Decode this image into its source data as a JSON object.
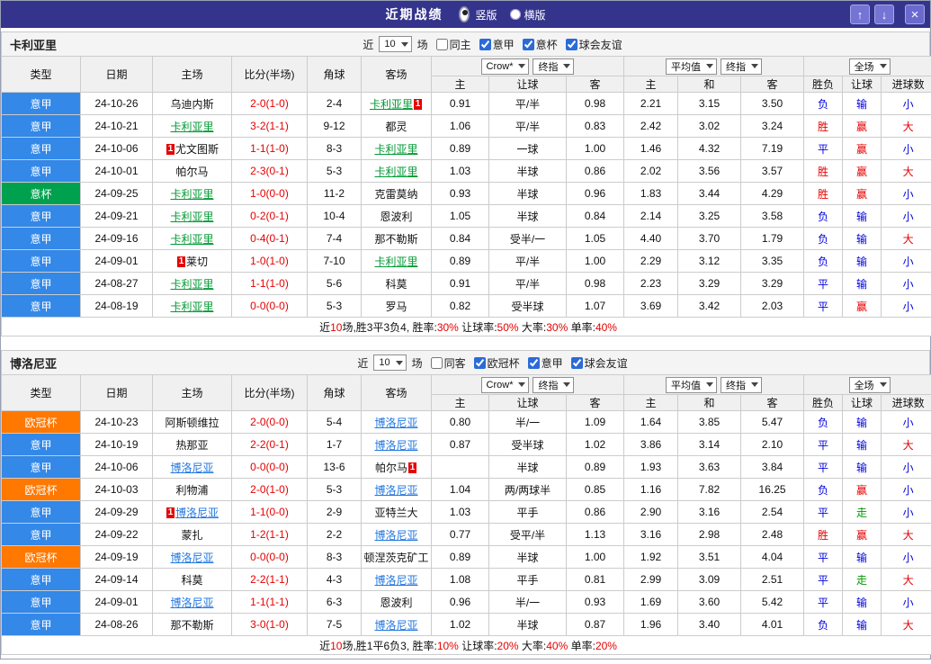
{
  "titlebar": {
    "title": "近期战绩",
    "radios": [
      {
        "label": "竖版",
        "selected": true
      },
      {
        "label": "横版",
        "selected": false
      }
    ]
  },
  "icons": {
    "up": "↑",
    "down": "↓",
    "close": "×",
    "chevron": "▼"
  },
  "header": {
    "static_cols": [
      "类型",
      "日期",
      "主场",
      "比分(半场)",
      "角球",
      "客场"
    ],
    "groups": [
      {
        "selects": [
          "Crow*",
          "终指"
        ],
        "cols": [
          "主",
          "让球",
          "客"
        ]
      },
      {
        "selects": [
          "平均值",
          "终指"
        ],
        "cols": [
          "主",
          "和",
          "客"
        ]
      },
      {
        "selects": [
          "全场"
        ],
        "cols": [
          "胜负",
          "让球",
          "进球数"
        ]
      }
    ]
  },
  "colors": {
    "type": {
      "意甲": "#3388e8",
      "意杯": "#00a14e",
      "欧冠杯": "#ff7800"
    },
    "result": {
      "胜": "#e60000",
      "赢": "#e60000",
      "大": "#e60000",
      "负": "#0000dd",
      "输": "#0000dd",
      "小": "#0000dd",
      "平": "#0000dd",
      "走": "#009900"
    }
  },
  "sections": [
    {
      "team": "卡利亚里",
      "focus_color": "#009933",
      "filter": {
        "prefix": "近",
        "count": "10",
        "suffix": "场",
        "checkboxes": [
          {
            "label": "同主",
            "checked": false
          },
          {
            "label": "意甲",
            "checked": true
          },
          {
            "label": "意杯",
            "checked": true
          },
          {
            "label": "球会友谊",
            "checked": true
          }
        ]
      },
      "rows": [
        {
          "type": "意甲",
          "date": "24-10-26",
          "home": {
            "name": "乌迪内斯",
            "focus": false
          },
          "score": "2-0(1-0)",
          "corners": "2-4",
          "away": {
            "name": "卡利亚里",
            "focus": true,
            "badge_after": "1"
          },
          "odds": [
            "0.91",
            "平/半",
            "0.98"
          ],
          "avg": [
            "2.21",
            "3.15",
            "3.50"
          ],
          "results": [
            "负",
            "输",
            "小"
          ]
        },
        {
          "type": "意甲",
          "date": "24-10-21",
          "home": {
            "name": "卡利亚里",
            "focus": true
          },
          "score": "3-2(1-1)",
          "corners": "9-12",
          "away": {
            "name": "都灵",
            "focus": false
          },
          "odds": [
            "1.06",
            "平/半",
            "0.83"
          ],
          "avg": [
            "2.42",
            "3.02",
            "3.24"
          ],
          "results": [
            "胜",
            "赢",
            "大"
          ]
        },
        {
          "type": "意甲",
          "date": "24-10-06",
          "home": {
            "name": "尤文图斯",
            "focus": false,
            "badge_before": "1"
          },
          "score": "1-1(1-0)",
          "corners": "8-3",
          "away": {
            "name": "卡利亚里",
            "focus": true
          },
          "odds": [
            "0.89",
            "一球",
            "1.00"
          ],
          "avg": [
            "1.46",
            "4.32",
            "7.19"
          ],
          "results": [
            "平",
            "赢",
            "小"
          ]
        },
        {
          "type": "意甲",
          "date": "24-10-01",
          "home": {
            "name": "帕尔马",
            "focus": false
          },
          "score": "2-3(0-1)",
          "corners": "5-3",
          "away": {
            "name": "卡利亚里",
            "focus": true
          },
          "odds": [
            "1.03",
            "半球",
            "0.86"
          ],
          "avg": [
            "2.02",
            "3.56",
            "3.57"
          ],
          "results": [
            "胜",
            "赢",
            "大"
          ]
        },
        {
          "type": "意杯",
          "date": "24-09-25",
          "home": {
            "name": "卡利亚里",
            "focus": true
          },
          "score": "1-0(0-0)",
          "corners": "11-2",
          "away": {
            "name": "克雷莫纳",
            "focus": false
          },
          "odds": [
            "0.93",
            "半球",
            "0.96"
          ],
          "avg": [
            "1.83",
            "3.44",
            "4.29"
          ],
          "results": [
            "胜",
            "赢",
            "小"
          ]
        },
        {
          "type": "意甲",
          "date": "24-09-21",
          "home": {
            "name": "卡利亚里",
            "focus": true
          },
          "score": "0-2(0-1)",
          "corners": "10-4",
          "away": {
            "name": "恩波利",
            "focus": false
          },
          "odds": [
            "1.05",
            "半球",
            "0.84"
          ],
          "avg": [
            "2.14",
            "3.25",
            "3.58"
          ],
          "results": [
            "负",
            "输",
            "小"
          ]
        },
        {
          "type": "意甲",
          "date": "24-09-16",
          "home": {
            "name": "卡利亚里",
            "focus": true
          },
          "score": "0-4(0-1)",
          "corners": "7-4",
          "away": {
            "name": "那不勒斯",
            "focus": false
          },
          "odds": [
            "0.84",
            "受半/一",
            "1.05"
          ],
          "avg": [
            "4.40",
            "3.70",
            "1.79"
          ],
          "results": [
            "负",
            "输",
            "大"
          ]
        },
        {
          "type": "意甲",
          "date": "24-09-01",
          "home": {
            "name": "莱切",
            "focus": false,
            "badge_before": "1"
          },
          "score": "1-0(1-0)",
          "corners": "7-10",
          "away": {
            "name": "卡利亚里",
            "focus": true
          },
          "odds": [
            "0.89",
            "平/半",
            "1.00"
          ],
          "avg": [
            "2.29",
            "3.12",
            "3.35"
          ],
          "results": [
            "负",
            "输",
            "小"
          ]
        },
        {
          "type": "意甲",
          "date": "24-08-27",
          "home": {
            "name": "卡利亚里",
            "focus": true
          },
          "score": "1-1(1-0)",
          "corners": "5-6",
          "away": {
            "name": "科莫",
            "focus": false
          },
          "odds": [
            "0.91",
            "平/半",
            "0.98"
          ],
          "avg": [
            "2.23",
            "3.29",
            "3.29"
          ],
          "results": [
            "平",
            "输",
            "小"
          ]
        },
        {
          "type": "意甲",
          "date": "24-08-19",
          "home": {
            "name": "卡利亚里",
            "focus": true
          },
          "score": "0-0(0-0)",
          "corners": "5-3",
          "away": {
            "name": "罗马",
            "focus": false
          },
          "odds": [
            "0.82",
            "受半球",
            "1.07"
          ],
          "avg": [
            "3.69",
            "3.42",
            "2.03"
          ],
          "results": [
            "平",
            "赢",
            "小"
          ]
        }
      ],
      "summary": [
        [
          "近",
          0
        ],
        [
          "10",
          1
        ],
        [
          "场,胜3平3负4, 胜率:",
          0
        ],
        [
          "30%",
          1
        ],
        [
          " 让球率:",
          0
        ],
        [
          "50%",
          1
        ],
        [
          " 大率:",
          0
        ],
        [
          "30%",
          1
        ],
        [
          " 单率:",
          0
        ],
        [
          "40%",
          1
        ]
      ]
    },
    {
      "team": "博洛尼亚",
      "focus_color": "#2277e0",
      "filter": {
        "prefix": "近",
        "count": "10",
        "suffix": "场",
        "checkboxes": [
          {
            "label": "同客",
            "checked": false
          },
          {
            "label": "欧冠杯",
            "checked": true
          },
          {
            "label": "意甲",
            "checked": true
          },
          {
            "label": "球会友谊",
            "checked": true
          }
        ]
      },
      "rows": [
        {
          "type": "欧冠杯",
          "date": "24-10-23",
          "home": {
            "name": "阿斯顿维拉",
            "focus": false
          },
          "score": "2-0(0-0)",
          "corners": "5-4",
          "away": {
            "name": "博洛尼亚",
            "focus": true
          },
          "odds": [
            "0.80",
            "半/一",
            "1.09"
          ],
          "avg": [
            "1.64",
            "3.85",
            "5.47"
          ],
          "results": [
            "负",
            "输",
            "小"
          ]
        },
        {
          "type": "意甲",
          "date": "24-10-19",
          "home": {
            "name": "热那亚",
            "focus": false
          },
          "score": "2-2(0-1)",
          "corners": "1-7",
          "away": {
            "name": "博洛尼亚",
            "focus": true
          },
          "odds": [
            "0.87",
            "受半球",
            "1.02"
          ],
          "avg": [
            "3.86",
            "3.14",
            "2.10"
          ],
          "results": [
            "平",
            "输",
            "大"
          ]
        },
        {
          "type": "意甲",
          "date": "24-10-06",
          "home": {
            "name": "博洛尼亚",
            "focus": true
          },
          "score": "0-0(0-0)",
          "corners": "13-6",
          "away": {
            "name": "帕尔马",
            "focus": false,
            "badge_after": "1"
          },
          "odds": [
            "",
            "半球",
            "0.89"
          ],
          "avg": [
            "1.93",
            "3.63",
            "3.84"
          ],
          "results": [
            "平",
            "输",
            "小"
          ]
        },
        {
          "type": "欧冠杯",
          "date": "24-10-03",
          "home": {
            "name": "利物浦",
            "focus": false
          },
          "score": "2-0(1-0)",
          "corners": "5-3",
          "away": {
            "name": "博洛尼亚",
            "focus": true
          },
          "odds": [
            "1.04",
            "两/两球半",
            "0.85"
          ],
          "avg": [
            "1.16",
            "7.82",
            "16.25"
          ],
          "results": [
            "负",
            "赢",
            "小"
          ]
        },
        {
          "type": "意甲",
          "date": "24-09-29",
          "home": {
            "name": "博洛尼亚",
            "focus": true,
            "badge_before": "1"
          },
          "score": "1-1(0-0)",
          "corners": "2-9",
          "away": {
            "name": "亚特兰大",
            "focus": false
          },
          "odds": [
            "1.03",
            "平手",
            "0.86"
          ],
          "avg": [
            "2.90",
            "3.16",
            "2.54"
          ],
          "results": [
            "平",
            "走",
            "小"
          ]
        },
        {
          "type": "意甲",
          "date": "24-09-22",
          "home": {
            "name": "蒙扎",
            "focus": false
          },
          "score": "1-2(1-1)",
          "corners": "2-2",
          "away": {
            "name": "博洛尼亚",
            "focus": true
          },
          "odds": [
            "0.77",
            "受平/半",
            "1.13"
          ],
          "avg": [
            "3.16",
            "2.98",
            "2.48"
          ],
          "results": [
            "胜",
            "赢",
            "大"
          ]
        },
        {
          "type": "欧冠杯",
          "date": "24-09-19",
          "home": {
            "name": "博洛尼亚",
            "focus": true
          },
          "score": "0-0(0-0)",
          "corners": "8-3",
          "away": {
            "name": "顿涅茨克矿工",
            "focus": false
          },
          "odds": [
            "0.89",
            "半球",
            "1.00"
          ],
          "avg": [
            "1.92",
            "3.51",
            "4.04"
          ],
          "results": [
            "平",
            "输",
            "小"
          ]
        },
        {
          "type": "意甲",
          "date": "24-09-14",
          "home": {
            "name": "科莫",
            "focus": false
          },
          "score": "2-2(1-1)",
          "corners": "4-3",
          "away": {
            "name": "博洛尼亚",
            "focus": true
          },
          "odds": [
            "1.08",
            "平手",
            "0.81"
          ],
          "avg": [
            "2.99",
            "3.09",
            "2.51"
          ],
          "results": [
            "平",
            "走",
            "大"
          ]
        },
        {
          "type": "意甲",
          "date": "24-09-01",
          "home": {
            "name": "博洛尼亚",
            "focus": true
          },
          "score": "1-1(1-1)",
          "corners": "6-3",
          "away": {
            "name": "恩波利",
            "focus": false
          },
          "odds": [
            "0.96",
            "半/一",
            "0.93"
          ],
          "avg": [
            "1.69",
            "3.60",
            "5.42"
          ],
          "results": [
            "平",
            "输",
            "小"
          ]
        },
        {
          "type": "意甲",
          "date": "24-08-26",
          "home": {
            "name": "那不勒斯",
            "focus": false
          },
          "score": "3-0(1-0)",
          "corners": "7-5",
          "away": {
            "name": "博洛尼亚",
            "focus": true
          },
          "odds": [
            "1.02",
            "半球",
            "0.87"
          ],
          "avg": [
            "1.96",
            "3.40",
            "4.01"
          ],
          "results": [
            "负",
            "输",
            "大"
          ]
        }
      ],
      "summary": [
        [
          "近",
          0
        ],
        [
          "10",
          1
        ],
        [
          "场,胜1平6负3, 胜率:",
          0
        ],
        [
          "10%",
          1
        ],
        [
          " 让球率:",
          0
        ],
        [
          "20%",
          1
        ],
        [
          " 大率:",
          0
        ],
        [
          "40%",
          1
        ],
        [
          " 单率:",
          0
        ],
        [
          "20%",
          1
        ]
      ]
    }
  ]
}
